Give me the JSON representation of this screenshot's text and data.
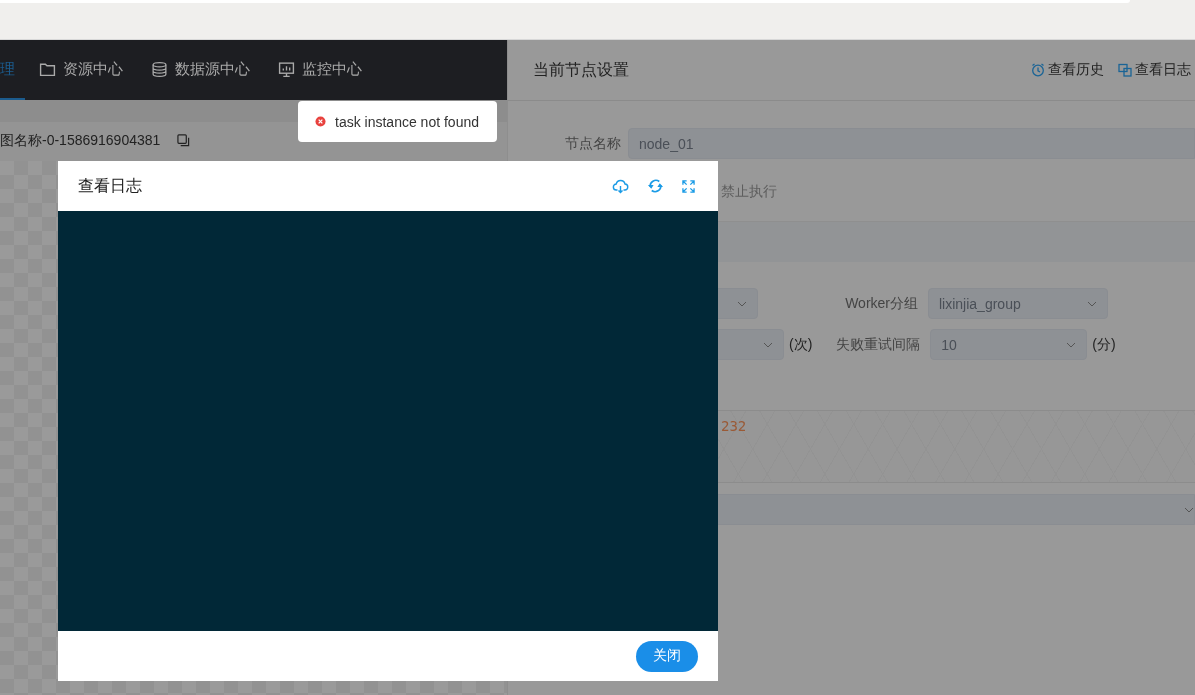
{
  "nav": {
    "items": [
      {
        "label": "理",
        "kind": "plain",
        "selected": true
      },
      {
        "label": "资源中心",
        "kind": "folder",
        "selected": false
      },
      {
        "label": "数据源中心",
        "kind": "database",
        "selected": false
      },
      {
        "label": "监控中心",
        "kind": "monitor",
        "selected": false
      }
    ]
  },
  "canvas": {
    "title": "图名称-0-1586916904381"
  },
  "node_panel": {
    "title": "当前节点设置",
    "links": [
      {
        "label": "查看历史",
        "kind": "clock"
      },
      {
        "label": "查看日志",
        "kind": "log"
      }
    ],
    "name_field": {
      "label": "节点名称",
      "value": "node_01"
    },
    "run_flag": {
      "label": "禁止执行"
    },
    "worker_group": {
      "label": "Worker分组",
      "value": "lixinjia_group"
    },
    "retry": {
      "unit": "(次)"
    },
    "retry_interval": {
      "label": "失败重试间隔",
      "value": "10",
      "unit": "(分)"
    },
    "script_fragment": "232"
  },
  "log_dialog": {
    "title": "查看日志",
    "close_button": "关闭"
  },
  "toast": {
    "kind": "error",
    "message": "task instance not found"
  }
}
